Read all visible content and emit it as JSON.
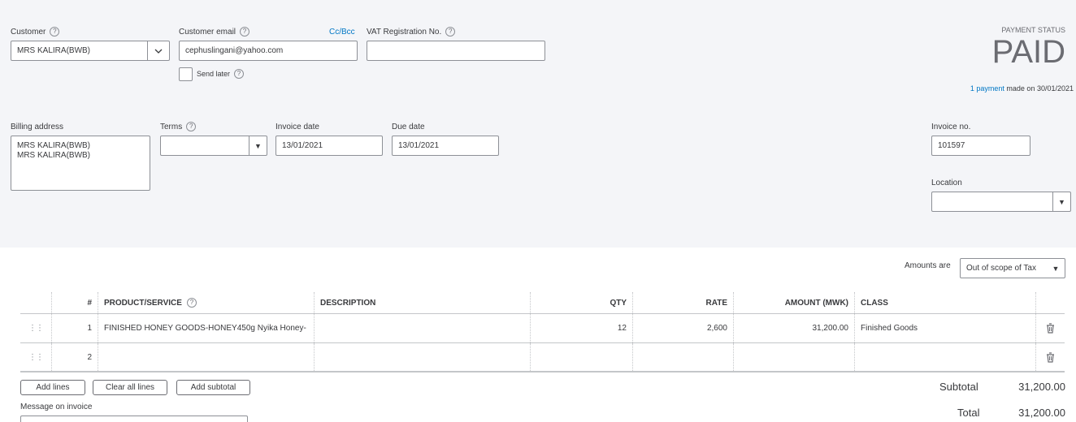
{
  "customer": {
    "label": "Customer",
    "value": "MRS KALIRA(BWB)"
  },
  "email": {
    "label": "Customer email",
    "value": "cephuslingani@yahoo.com",
    "ccbcc": "Cc/Bcc",
    "send_later": "Send later"
  },
  "vat": {
    "label": "VAT Registration No.",
    "value": ""
  },
  "payment_status": {
    "label": "PAYMENT STATUS",
    "value": "PAID",
    "link": "1 payment",
    "made_on": "made on 30/01/2021"
  },
  "billing": {
    "label": "Billing address",
    "line1": "MRS KALIRA(BWB)",
    "line2": "MRS KALIRA(BWB)"
  },
  "terms": {
    "label": "Terms",
    "value": ""
  },
  "invoice_date": {
    "label": "Invoice date",
    "value": "13/01/2021"
  },
  "due_date": {
    "label": "Due date",
    "value": "13/01/2021"
  },
  "invoice_no": {
    "label": "Invoice no.",
    "value": "101597"
  },
  "location": {
    "label": "Location",
    "value": ""
  },
  "amounts": {
    "label": "Amounts are",
    "value": "Out of scope of Tax"
  },
  "table": {
    "headers": {
      "num": "#",
      "product": "PRODUCT/SERVICE",
      "description": "DESCRIPTION",
      "qty": "QTY",
      "rate": "RATE",
      "amount": "AMOUNT (MWK)",
      "class": "CLASS"
    },
    "rows": [
      {
        "num": "1",
        "product": "FINISHED HONEY GOODS-HONEY450g Nyika Honey-",
        "description": "",
        "qty": "12",
        "rate": "2,600",
        "amount": "31,200.00",
        "class": "Finished Goods"
      },
      {
        "num": "2",
        "product": "",
        "description": "",
        "qty": "",
        "rate": "",
        "amount": "",
        "class": ""
      }
    ]
  },
  "buttons": {
    "add_lines": "Add lines",
    "clear_all": "Clear all lines",
    "add_subtotal": "Add subtotal"
  },
  "message": {
    "label": "Message on invoice"
  },
  "totals": {
    "subtotal_label": "Subtotal",
    "subtotal": "31,200.00",
    "total_label": "Total",
    "total": "31,200.00"
  },
  "icons": {
    "help": "help-circle-icon",
    "dropdown": "chevron-down-icon",
    "drag": "drag-handle-icon",
    "delete": "trash-icon"
  }
}
